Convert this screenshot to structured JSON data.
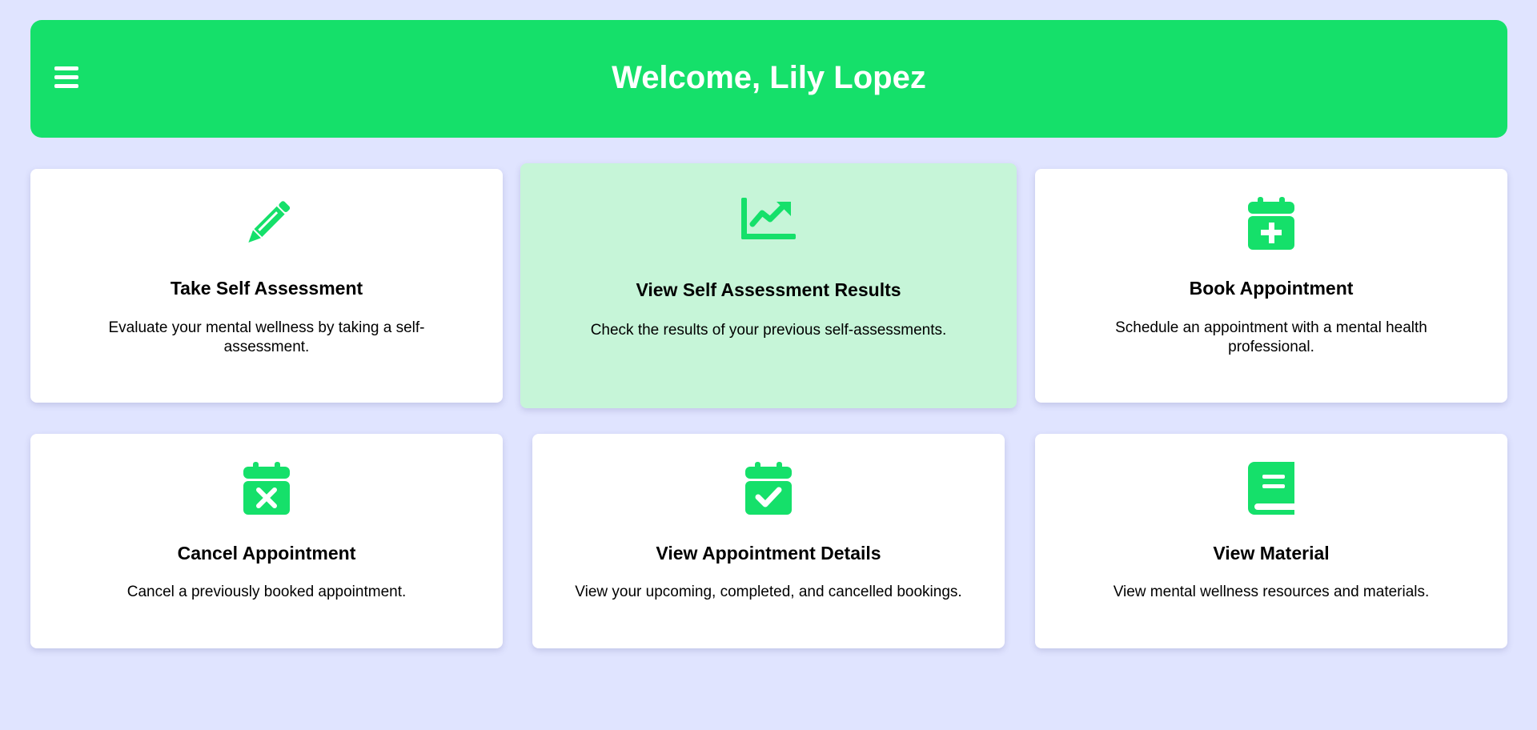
{
  "header": {
    "title": "Welcome, Lily Lopez",
    "menu_icon": "hamburger-menu-icon"
  },
  "colors": {
    "accent": "#15e06a",
    "background": "#e0e4ff",
    "card": "#ffffff",
    "card_hover": "#c6f5d8"
  },
  "cards": [
    {
      "icon": "pencil-icon",
      "title": "Take Self Assessment",
      "description": "Evaluate your mental wellness by taking a self-assessment."
    },
    {
      "icon": "chart-line-icon",
      "title": "View Self Assessment Results",
      "description": "Check the results of your previous self-assessments."
    },
    {
      "icon": "calendar-plus-icon",
      "title": "Book Appointment",
      "description": "Schedule an appointment with a mental health professional."
    },
    {
      "icon": "calendar-xmark-icon",
      "title": "Cancel Appointment",
      "description": "Cancel a previously booked appointment."
    },
    {
      "icon": "calendar-check-icon",
      "title": "View Appointment Details",
      "description": "View your upcoming, completed, and cancelled bookings."
    },
    {
      "icon": "book-icon",
      "title": "View Material",
      "description": "View mental wellness resources and materials."
    }
  ]
}
